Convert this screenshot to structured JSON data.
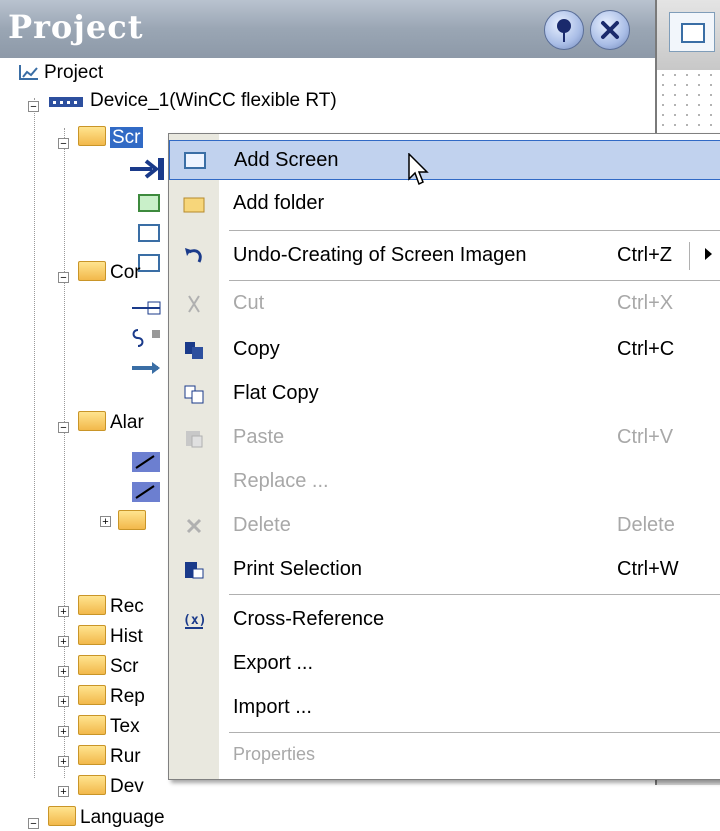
{
  "window": {
    "title": "Project"
  },
  "tree": {
    "root": "Project",
    "device": "Device_1(WinCC flexible RT)",
    "screens_label": "Scr",
    "comm_label": "Cor",
    "alarm_label": "Alar",
    "items": [
      "Rec",
      "Hist",
      "Scr",
      "Rep",
      "Tex",
      "Rur",
      "Dev"
    ],
    "language_label": "Language"
  },
  "context_menu": {
    "items": [
      {
        "label": "Add Screen",
        "shortcut": "",
        "icon": "screen-icon"
      },
      {
        "label": "Add folder",
        "shortcut": "",
        "icon": "folder-icon"
      },
      {
        "label": "Undo-Creating of Screen Imagen",
        "shortcut": "Ctrl+Z",
        "icon": "undo-icon"
      },
      {
        "label": "Cut",
        "shortcut": "Ctrl+X",
        "icon": "cut-icon"
      },
      {
        "label": "Copy",
        "shortcut": "Ctrl+C",
        "icon": "copy-icon"
      },
      {
        "label": "Flat Copy",
        "shortcut": "",
        "icon": "flat-copy-icon"
      },
      {
        "label": "Paste",
        "shortcut": "Ctrl+V",
        "icon": "paste-icon"
      },
      {
        "label": "Replace ...",
        "shortcut": "",
        "icon": ""
      },
      {
        "label": "Delete",
        "shortcut": "Delete",
        "icon": "delete-icon"
      },
      {
        "label": "Print Selection",
        "shortcut": "Ctrl+W",
        "icon": "print-icon"
      },
      {
        "label": "Cross-Reference",
        "shortcut": "",
        "icon": "cross-reference-icon"
      },
      {
        "label": "Export ...",
        "shortcut": "",
        "icon": ""
      },
      {
        "label": "Import ...",
        "shortcut": "",
        "icon": ""
      },
      {
        "label": "Properties",
        "shortcut": "",
        "icon": ""
      }
    ]
  }
}
